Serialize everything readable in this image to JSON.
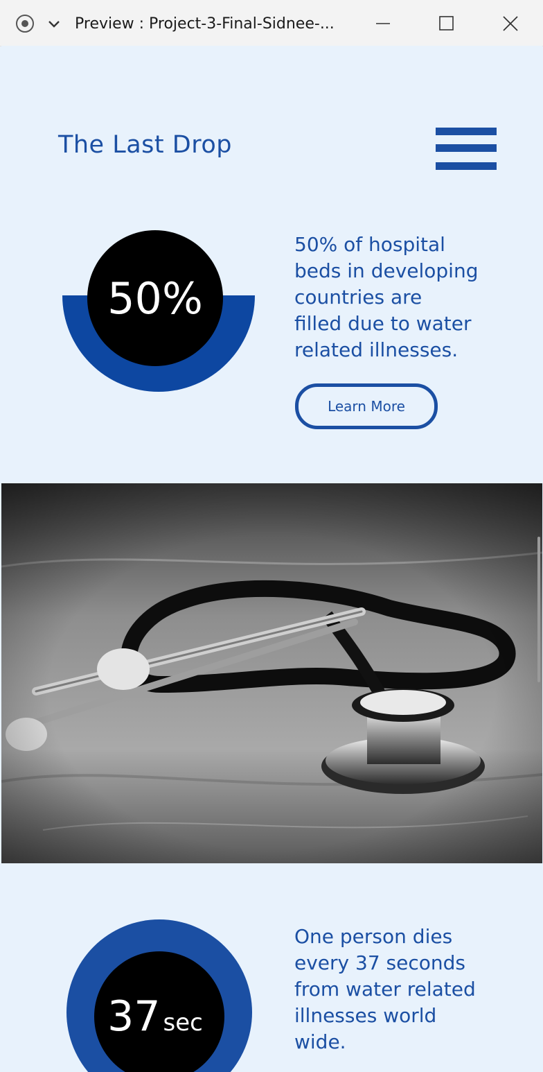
{
  "window": {
    "title": "Preview : Project-3-Final-Sidnee-...",
    "controls": [
      "minimize",
      "maximize",
      "close"
    ]
  },
  "site": {
    "brand": "The Last Drop",
    "menu_icon": "hamburger-menu-icon",
    "accent_color": "#1b4fa3",
    "background_color": "#e8f2fc"
  },
  "stats": [
    {
      "value": "50%",
      "text_lines": [
        "50% of hospital",
        "beds in developing",
        "countries are",
        "filled due to water",
        "related illnesses."
      ],
      "button": "Learn More"
    },
    {
      "value": "37",
      "unit": "sec",
      "text_lines": [
        "One person dies",
        "every 37 seconds",
        "from water related",
        "illnesses world",
        "wide."
      ]
    }
  ],
  "image": {
    "subject": "stethoscope-photo",
    "style": "black-and-white"
  }
}
